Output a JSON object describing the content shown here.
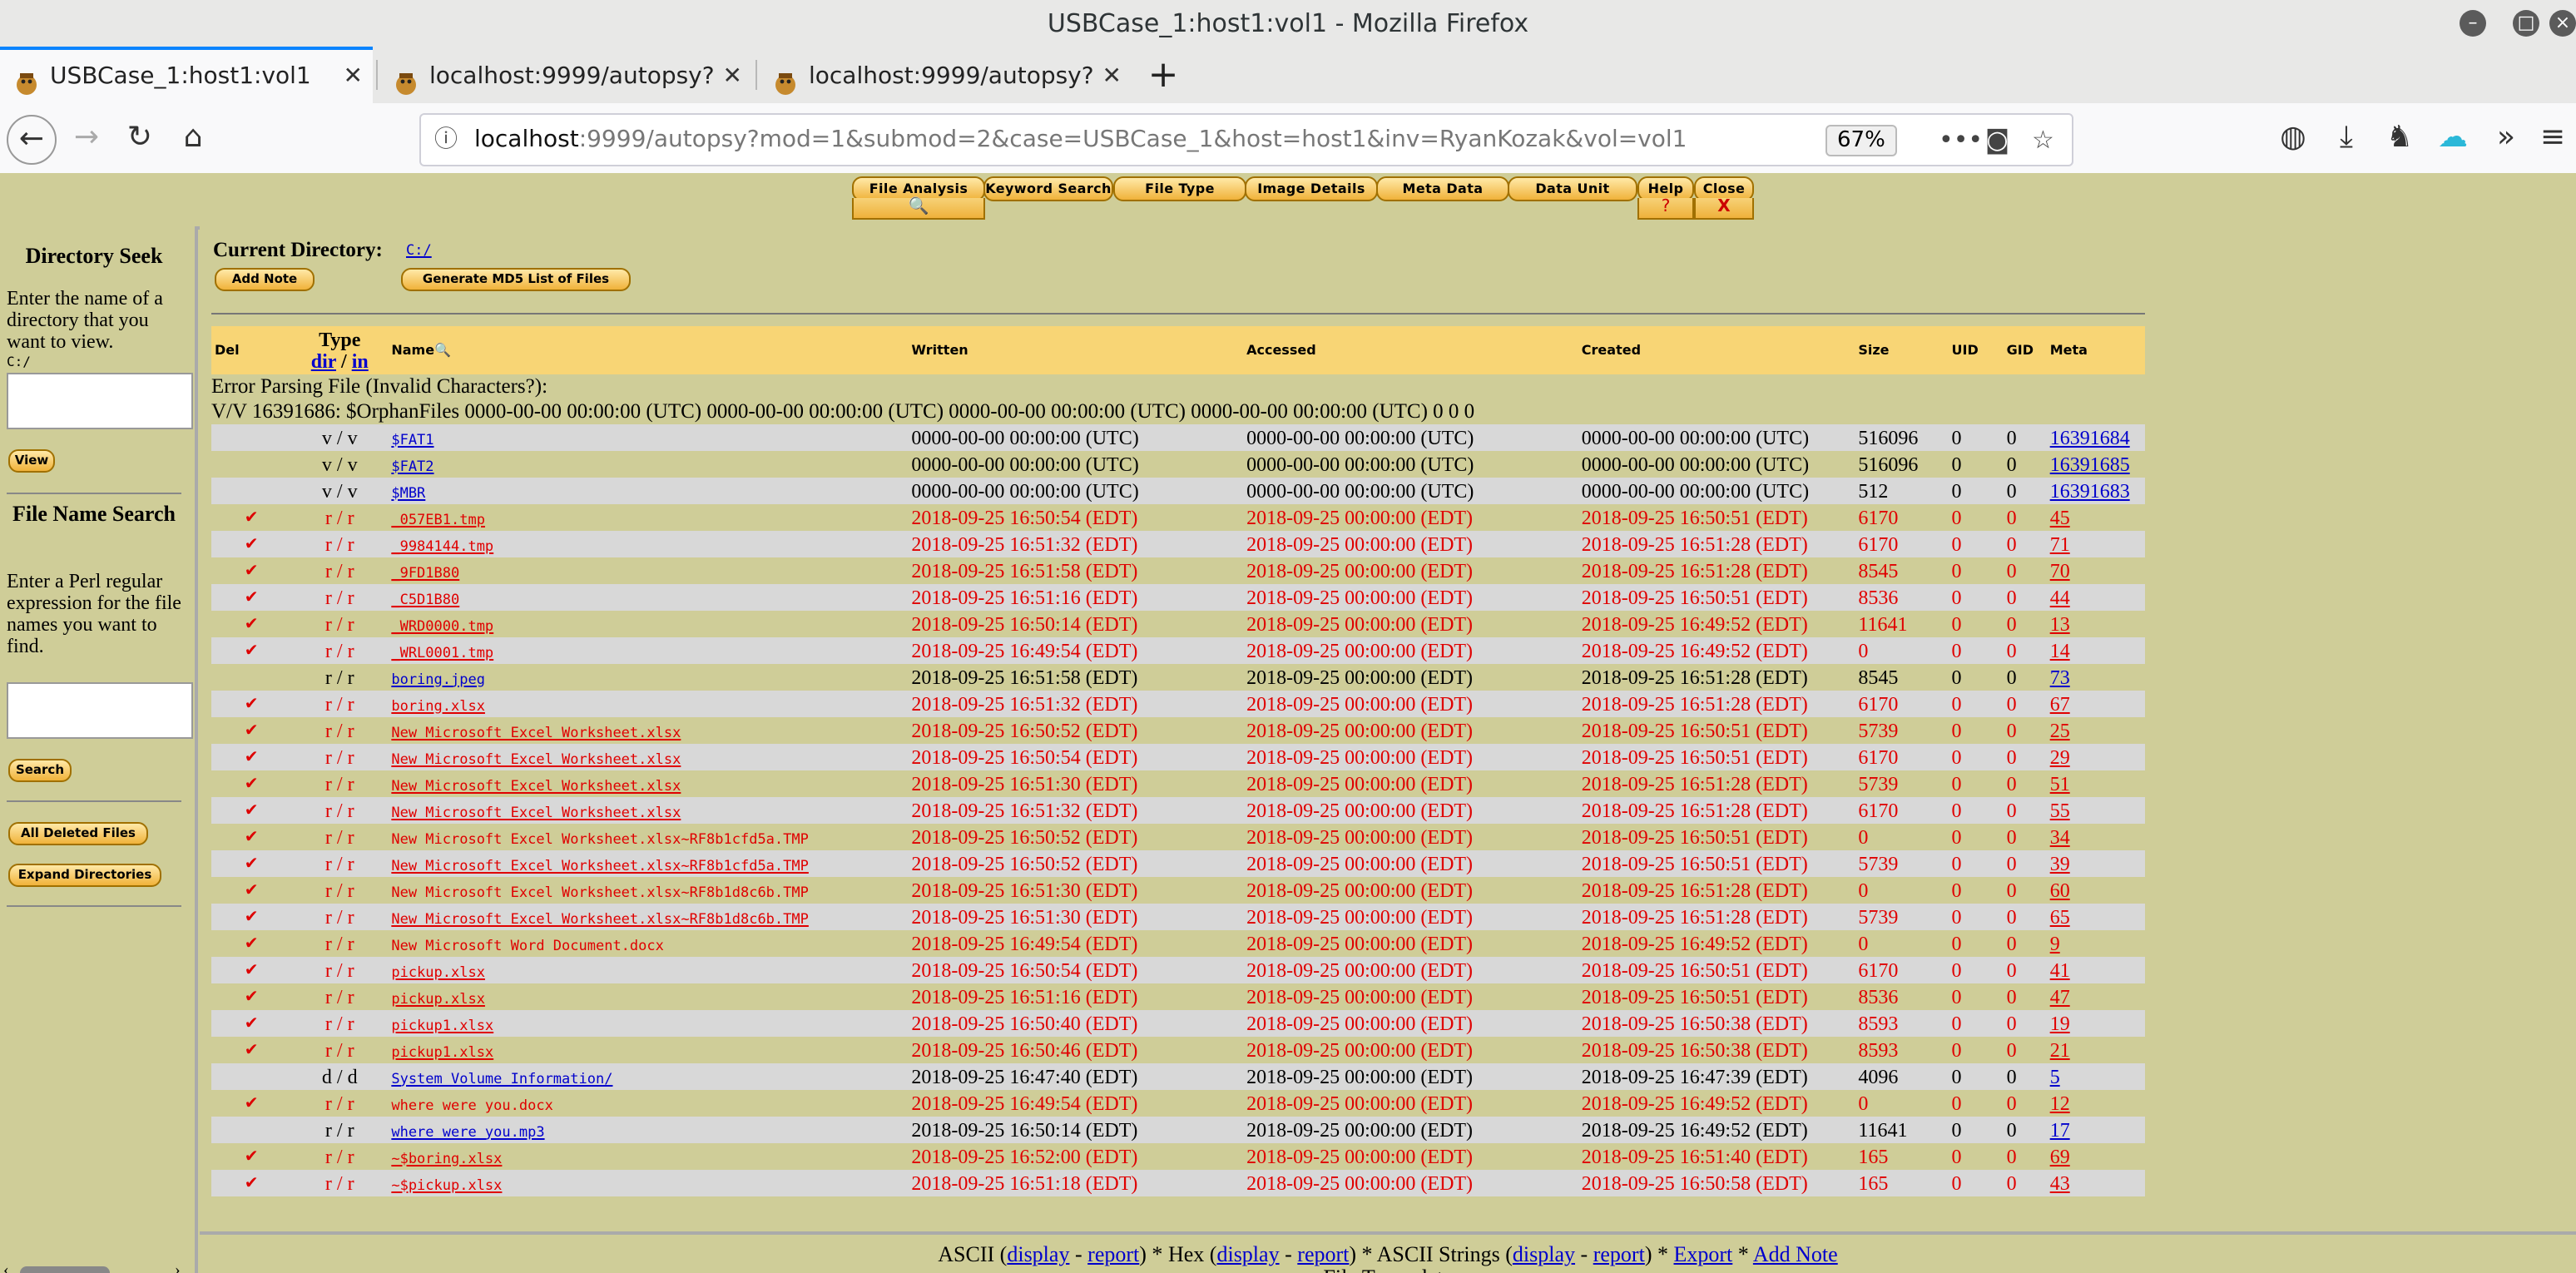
{
  "window": {
    "title": "USBCase_1:host1:vol1 - Mozilla Firefox"
  },
  "tabs": [
    {
      "label": "USBCase_1:host1:vol1",
      "active": true
    },
    {
      "label": "localhost:9999/autopsy?",
      "active": false
    },
    {
      "label": "localhost:9999/autopsy?",
      "active": false
    }
  ],
  "address": {
    "host": "localhost",
    "rest": ":9999/autopsy?mod=1&submod=2&case=USBCase_1&host=host1&inv=RyanKozak&vol=vol1",
    "zoom": "67%"
  },
  "toolbar": {
    "file_analysis": "File Analysis",
    "keyword_search": "Keyword Search",
    "file_type": "File Type",
    "image_details": "Image Details",
    "meta_data": "Meta Data",
    "data_unit": "Data Unit",
    "help": "Help",
    "close": "Close",
    "help_sub": "?",
    "close_sub": "X"
  },
  "left": {
    "dir_title": "Directory Seek",
    "dir_desc": "Enter the name of a directory that you want to view.",
    "dir_hint": "C:/",
    "view": "View",
    "fn_title": "File Name Search",
    "fn_desc": "Enter a Perl regular expression for the file names you want to find.",
    "search": "Search",
    "all_deleted": "All Deleted Files",
    "expand_dirs": "Expand Directories"
  },
  "main": {
    "current_dir_label": "Current Directory:",
    "current_dir": "C:/",
    "add_note": "Add Note",
    "md5": "Generate MD5 List of Files",
    "error": "Error Parsing File (Invalid Characters?):",
    "orphan": "V/V 16391686: $OrphanFiles 0000-00-00 00:00:00 (UTC) 0000-00-00 00:00:00 (UTC) 0000-00-00 00:00:00 (UTC) 0000-00-00 00:00:00 (UTC) 0 0 0"
  },
  "table": {
    "headers": {
      "del": "Del",
      "type": "Type",
      "type_dir": "dir",
      "type_sep": "/",
      "type_in": "in",
      "name": "Name",
      "written": "Written",
      "accessed": "Accessed",
      "created": "Created",
      "size": "Size",
      "uid": "UID",
      "gid": "GID",
      "meta": "Meta"
    },
    "rows": [
      {
        "del": "",
        "type": "v / v",
        "name": "$FAT1",
        "written": "0000-00-00 00:00:00 (UTC)",
        "accessed": "0000-00-00 00:00:00 (UTC)",
        "created": "0000-00-00 00:00:00 (UTC)",
        "size": "516096",
        "uid": "0",
        "gid": "0",
        "meta": "16391684",
        "deleted": false
      },
      {
        "del": "",
        "type": "v / v",
        "name": "$FAT2",
        "written": "0000-00-00 00:00:00 (UTC)",
        "accessed": "0000-00-00 00:00:00 (UTC)",
        "created": "0000-00-00 00:00:00 (UTC)",
        "size": "516096",
        "uid": "0",
        "gid": "0",
        "meta": "16391685",
        "deleted": false
      },
      {
        "del": "",
        "type": "v / v",
        "name": "$MBR",
        "written": "0000-00-00 00:00:00 (UTC)",
        "accessed": "0000-00-00 00:00:00 (UTC)",
        "created": "0000-00-00 00:00:00 (UTC)",
        "size": "512",
        "uid": "0",
        "gid": "0",
        "meta": "16391683",
        "deleted": false
      },
      {
        "del": "✔",
        "type": "r / r",
        "name": "_057EB1.tmp",
        "written": "2018-09-25 16:50:54 (EDT)",
        "accessed": "2018-09-25 00:00:00 (EDT)",
        "created": "2018-09-25 16:50:51 (EDT)",
        "size": "6170",
        "uid": "0",
        "gid": "0",
        "meta": "45",
        "deleted": true
      },
      {
        "del": "✔",
        "type": "r / r",
        "name": "_9984144.tmp",
        "written": "2018-09-25 16:51:32 (EDT)",
        "accessed": "2018-09-25 00:00:00 (EDT)",
        "created": "2018-09-25 16:51:28 (EDT)",
        "size": "6170",
        "uid": "0",
        "gid": "0",
        "meta": "71",
        "deleted": true
      },
      {
        "del": "✔",
        "type": "r / r",
        "name": "_9FD1B80",
        "written": "2018-09-25 16:51:58 (EDT)",
        "accessed": "2018-09-25 00:00:00 (EDT)",
        "created": "2018-09-25 16:51:28 (EDT)",
        "size": "8545",
        "uid": "0",
        "gid": "0",
        "meta": "70",
        "deleted": true
      },
      {
        "del": "✔",
        "type": "r / r",
        "name": "_C5D1B80",
        "written": "2018-09-25 16:51:16 (EDT)",
        "accessed": "2018-09-25 00:00:00 (EDT)",
        "created": "2018-09-25 16:50:51 (EDT)",
        "size": "8536",
        "uid": "0",
        "gid": "0",
        "meta": "44",
        "deleted": true
      },
      {
        "del": "✔",
        "type": "r / r",
        "name": "_WRD0000.tmp",
        "written": "2018-09-25 16:50:14 (EDT)",
        "accessed": "2018-09-25 00:00:00 (EDT)",
        "created": "2018-09-25 16:49:52 (EDT)",
        "size": "11641",
        "uid": "0",
        "gid": "0",
        "meta": "13",
        "deleted": true
      },
      {
        "del": "✔",
        "type": "r / r",
        "name": "_WRL0001.tmp",
        "written": "2018-09-25 16:49:54 (EDT)",
        "accessed": "2018-09-25 00:00:00 (EDT)",
        "created": "2018-09-25 16:49:52 (EDT)",
        "size": "0",
        "uid": "0",
        "gid": "0",
        "meta": "14",
        "deleted": true
      },
      {
        "del": "",
        "type": "r / r",
        "name": "boring.jpeg",
        "written": "2018-09-25 16:51:58 (EDT)",
        "accessed": "2018-09-25 00:00:00 (EDT)",
        "created": "2018-09-25 16:51:28 (EDT)",
        "size": "8545",
        "uid": "0",
        "gid": "0",
        "meta": "73",
        "deleted": false
      },
      {
        "del": "✔",
        "type": "r / r",
        "name": "boring.xlsx",
        "written": "2018-09-25 16:51:32 (EDT)",
        "accessed": "2018-09-25 00:00:00 (EDT)",
        "created": "2018-09-25 16:51:28 (EDT)",
        "size": "6170",
        "uid": "0",
        "gid": "0",
        "meta": "67",
        "deleted": true
      },
      {
        "del": "✔",
        "type": "r / r",
        "name": "New Microsoft Excel Worksheet.xlsx",
        "written": "2018-09-25 16:50:52 (EDT)",
        "accessed": "2018-09-25 00:00:00 (EDT)",
        "created": "2018-09-25 16:50:51 (EDT)",
        "size": "5739",
        "uid": "0",
        "gid": "0",
        "meta": "25",
        "deleted": true
      },
      {
        "del": "✔",
        "type": "r / r",
        "name": "New Microsoft Excel Worksheet.xlsx",
        "written": "2018-09-25 16:50:54 (EDT)",
        "accessed": "2018-09-25 00:00:00 (EDT)",
        "created": "2018-09-25 16:50:51 (EDT)",
        "size": "6170",
        "uid": "0",
        "gid": "0",
        "meta": "29",
        "deleted": true
      },
      {
        "del": "✔",
        "type": "r / r",
        "name": "New Microsoft Excel Worksheet.xlsx",
        "written": "2018-09-25 16:51:30 (EDT)",
        "accessed": "2018-09-25 00:00:00 (EDT)",
        "created": "2018-09-25 16:51:28 (EDT)",
        "size": "5739",
        "uid": "0",
        "gid": "0",
        "meta": "51",
        "deleted": true
      },
      {
        "del": "✔",
        "type": "r / r",
        "name": "New Microsoft Excel Worksheet.xlsx",
        "written": "2018-09-25 16:51:32 (EDT)",
        "accessed": "2018-09-25 00:00:00 (EDT)",
        "created": "2018-09-25 16:51:28 (EDT)",
        "size": "6170",
        "uid": "0",
        "gid": "0",
        "meta": "55",
        "deleted": true
      },
      {
        "del": "✔",
        "type": "r / r",
        "name": "New Microsoft Excel Worksheet.xlsx~RF8b1cfd5a.TMP",
        "written": "2018-09-25 16:50:52 (EDT)",
        "accessed": "2018-09-25 00:00:00 (EDT)",
        "created": "2018-09-25 16:50:51 (EDT)",
        "size": "0",
        "uid": "0",
        "gid": "0",
        "meta": "34",
        "deleted": true,
        "nolink": true
      },
      {
        "del": "✔",
        "type": "r / r",
        "name": "New Microsoft Excel Worksheet.xlsx~RF8b1cfd5a.TMP",
        "written": "2018-09-25 16:50:52 (EDT)",
        "accessed": "2018-09-25 00:00:00 (EDT)",
        "created": "2018-09-25 16:50:51 (EDT)",
        "size": "5739",
        "uid": "0",
        "gid": "0",
        "meta": "39",
        "deleted": true
      },
      {
        "del": "✔",
        "type": "r / r",
        "name": "New Microsoft Excel Worksheet.xlsx~RF8b1d8c6b.TMP",
        "written": "2018-09-25 16:51:30 (EDT)",
        "accessed": "2018-09-25 00:00:00 (EDT)",
        "created": "2018-09-25 16:51:28 (EDT)",
        "size": "0",
        "uid": "0",
        "gid": "0",
        "meta": "60",
        "deleted": true,
        "nolink": true
      },
      {
        "del": "✔",
        "type": "r / r",
        "name": "New Microsoft Excel Worksheet.xlsx~RF8b1d8c6b.TMP",
        "written": "2018-09-25 16:51:30 (EDT)",
        "accessed": "2018-09-25 00:00:00 (EDT)",
        "created": "2018-09-25 16:51:28 (EDT)",
        "size": "5739",
        "uid": "0",
        "gid": "0",
        "meta": "65",
        "deleted": true
      },
      {
        "del": "✔",
        "type": "r / r",
        "name": "New Microsoft Word Document.docx",
        "written": "2018-09-25 16:49:54 (EDT)",
        "accessed": "2018-09-25 00:00:00 (EDT)",
        "created": "2018-09-25 16:49:52 (EDT)",
        "size": "0",
        "uid": "0",
        "gid": "0",
        "meta": "9",
        "deleted": true,
        "nolink": true
      },
      {
        "del": "✔",
        "type": "r / r",
        "name": "pickup.xlsx",
        "written": "2018-09-25 16:50:54 (EDT)",
        "accessed": "2018-09-25 00:00:00 (EDT)",
        "created": "2018-09-25 16:50:51 (EDT)",
        "size": "6170",
        "uid": "0",
        "gid": "0",
        "meta": "41",
        "deleted": true
      },
      {
        "del": "✔",
        "type": "r / r",
        "name": "pickup.xlsx",
        "written": "2018-09-25 16:51:16 (EDT)",
        "accessed": "2018-09-25 00:00:00 (EDT)",
        "created": "2018-09-25 16:50:51 (EDT)",
        "size": "8536",
        "uid": "0",
        "gid": "0",
        "meta": "47",
        "deleted": true
      },
      {
        "del": "✔",
        "type": "r / r",
        "name": "pickup1.xlsx",
        "written": "2018-09-25 16:50:40 (EDT)",
        "accessed": "2018-09-25 00:00:00 (EDT)",
        "created": "2018-09-25 16:50:38 (EDT)",
        "size": "8593",
        "uid": "0",
        "gid": "0",
        "meta": "19",
        "deleted": true
      },
      {
        "del": "✔",
        "type": "r / r",
        "name": "pickup1.xlsx",
        "written": "2018-09-25 16:50:46 (EDT)",
        "accessed": "2018-09-25 00:00:00 (EDT)",
        "created": "2018-09-25 16:50:38 (EDT)",
        "size": "8593",
        "uid": "0",
        "gid": "0",
        "meta": "21",
        "deleted": true
      },
      {
        "del": "",
        "type": "d / d",
        "name": "System Volume Information/",
        "written": "2018-09-25 16:47:40 (EDT)",
        "accessed": "2018-09-25 00:00:00 (EDT)",
        "created": "2018-09-25 16:47:39 (EDT)",
        "size": "4096",
        "uid": "0",
        "gid": "0",
        "meta": "5",
        "deleted": false
      },
      {
        "del": "✔",
        "type": "r / r",
        "name": "where were you.docx",
        "written": "2018-09-25 16:49:54 (EDT)",
        "accessed": "2018-09-25 00:00:00 (EDT)",
        "created": "2018-09-25 16:49:52 (EDT)",
        "size": "0",
        "uid": "0",
        "gid": "0",
        "meta": "12",
        "deleted": true,
        "nolink": true
      },
      {
        "del": "",
        "type": "r / r",
        "name": "where were you.mp3",
        "written": "2018-09-25 16:50:14 (EDT)",
        "accessed": "2018-09-25 00:00:00 (EDT)",
        "created": "2018-09-25 16:49:52 (EDT)",
        "size": "11641",
        "uid": "0",
        "gid": "0",
        "meta": "17",
        "deleted": false
      },
      {
        "del": "✔",
        "type": "r / r",
        "name": "~$boring.xlsx",
        "written": "2018-09-25 16:52:00 (EDT)",
        "accessed": "2018-09-25 00:00:00 (EDT)",
        "created": "2018-09-25 16:51:40 (EDT)",
        "size": "165",
        "uid": "0",
        "gid": "0",
        "meta": "69",
        "deleted": true
      },
      {
        "del": "✔",
        "type": "r / r",
        "name": "~$pickup.xlsx",
        "written": "2018-09-25 16:51:18 (EDT)",
        "accessed": "2018-09-25 00:00:00 (EDT)",
        "created": "2018-09-25 16:50:58 (EDT)",
        "size": "165",
        "uid": "0",
        "gid": "0",
        "meta": "43",
        "deleted": true
      }
    ]
  },
  "bottom": {
    "ascii": "ASCII",
    "hex": "Hex",
    "ascii_strings": "ASCII Strings",
    "display": "display",
    "report": "report",
    "export": "Export",
    "add_note": "Add Note",
    "filetype": "File Type: data"
  },
  "colors": {
    "background": "#cfcd98",
    "header": "#f8d575",
    "deleted": "#e00000",
    "link": "#0000cc"
  }
}
